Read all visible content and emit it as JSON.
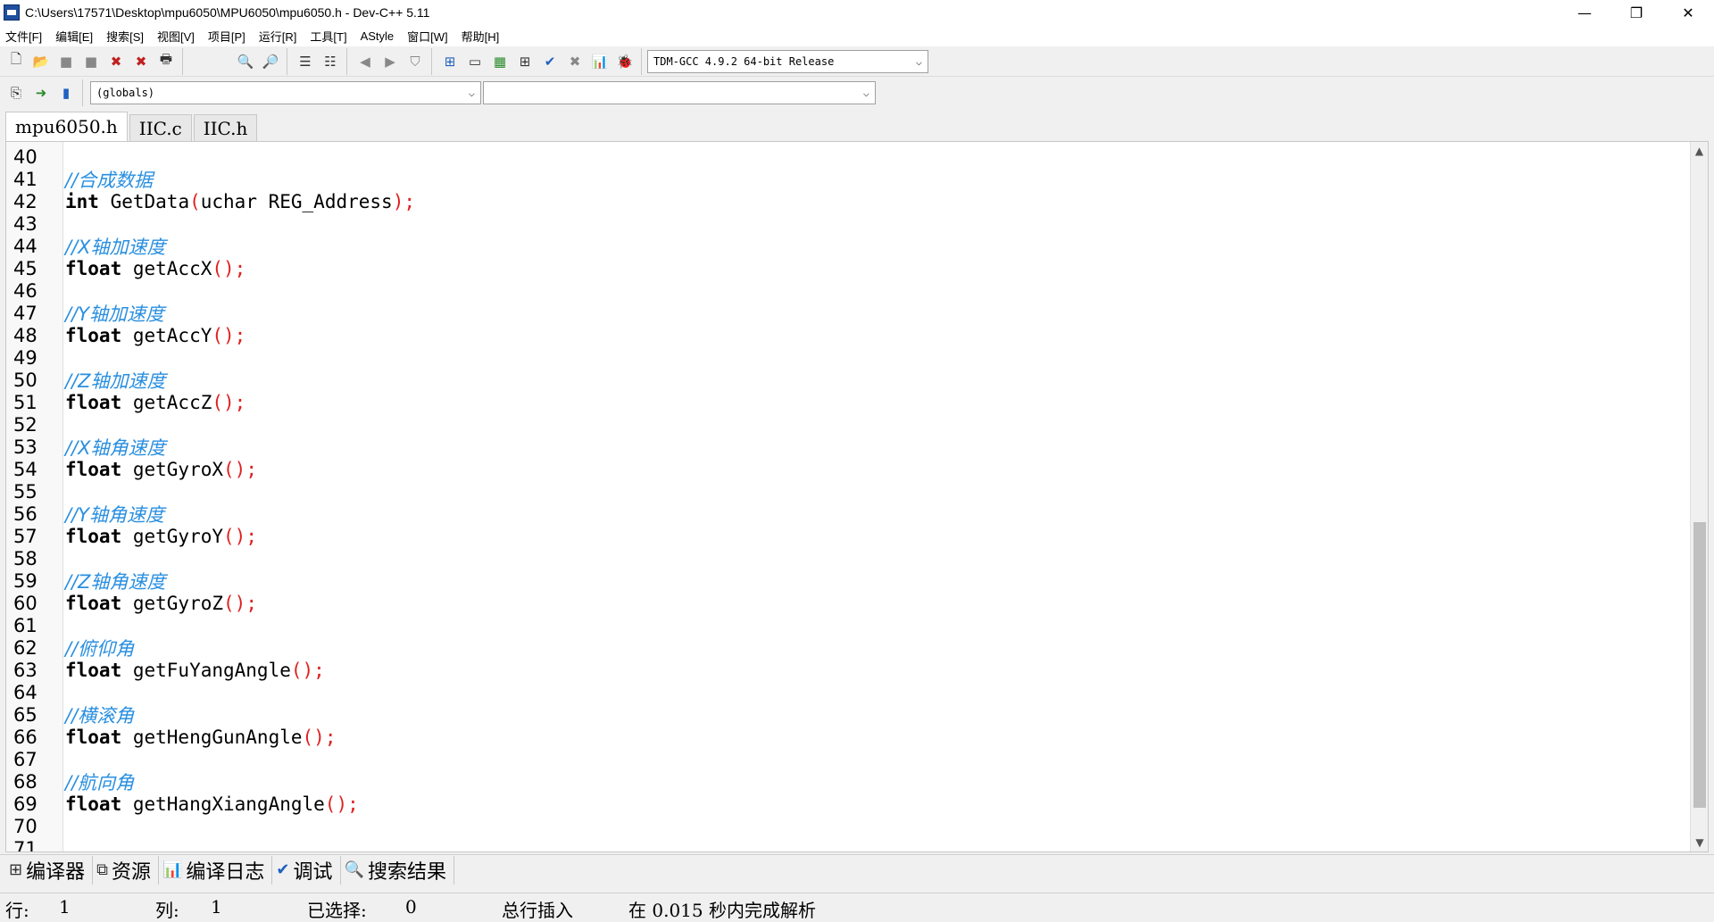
{
  "window": {
    "title": "C:\\Users\\17571\\Desktop\\mpu6050\\MPU6050\\mpu6050.h - Dev-C++ 5.11",
    "minimize": "—",
    "restore": "❐",
    "close": "✕"
  },
  "menu": [
    "文件[F]",
    "编辑[E]",
    "搜索[S]",
    "视图[V]",
    "项目[P]",
    "运行[R]",
    "工具[T]",
    "AStyle",
    "窗口[W]",
    "帮助[H]"
  ],
  "toolbar": {
    "compiler": "TDM-GCC 4.9.2 64-bit Release",
    "scope": "(globals)",
    "symbol": ""
  },
  "tabs": [
    "mpu6050.h",
    "IIC.c",
    "IIC.h"
  ],
  "code": [
    {
      "n": "40",
      "t": ""
    },
    {
      "n": "41",
      "c": "//合成数据"
    },
    {
      "n": "42",
      "k": "int",
      "f": " GetData",
      "a": "uchar REG_Address"
    },
    {
      "n": "43",
      "t": ""
    },
    {
      "n": "44",
      "c": "//X轴加速度"
    },
    {
      "n": "45",
      "k": "float",
      "f": " getAccX",
      "a": ""
    },
    {
      "n": "46",
      "t": ""
    },
    {
      "n": "47",
      "c": "//Y轴加速度"
    },
    {
      "n": "48",
      "k": "float",
      "f": " getAccY",
      "a": ""
    },
    {
      "n": "49",
      "t": ""
    },
    {
      "n": "50",
      "c": "//Z轴加速度"
    },
    {
      "n": "51",
      "k": "float",
      "f": " getAccZ",
      "a": ""
    },
    {
      "n": "52",
      "t": ""
    },
    {
      "n": "53",
      "c": "//X轴角速度"
    },
    {
      "n": "54",
      "k": "float",
      "f": " getGyroX",
      "a": ""
    },
    {
      "n": "55",
      "t": ""
    },
    {
      "n": "56",
      "c": "//Y轴角速度"
    },
    {
      "n": "57",
      "k": "float",
      "f": " getGyroY",
      "a": ""
    },
    {
      "n": "58",
      "t": ""
    },
    {
      "n": "59",
      "c": "//Z轴角速度"
    },
    {
      "n": "60",
      "k": "float",
      "f": " getGyroZ",
      "a": ""
    },
    {
      "n": "61",
      "t": ""
    },
    {
      "n": "62",
      "c": "//俯仰角"
    },
    {
      "n": "63",
      "k": "float",
      "f": " getFuYangAngle",
      "a": ""
    },
    {
      "n": "64",
      "t": ""
    },
    {
      "n": "65",
      "c": "//横滚角"
    },
    {
      "n": "66",
      "k": "float",
      "f": " getHengGunAngle",
      "a": ""
    },
    {
      "n": "67",
      "t": ""
    },
    {
      "n": "68",
      "c": "//航向角"
    },
    {
      "n": "69",
      "k": "float",
      "f": " getHangXiangAngle",
      "a": ""
    },
    {
      "n": "70",
      "t": ""
    },
    {
      "n": "71",
      "t": ""
    }
  ],
  "bottom_tabs": [
    {
      "icon": "compiler-icon",
      "label": "编译器"
    },
    {
      "icon": "resources-icon",
      "label": "资源"
    },
    {
      "icon": "compile-log-icon",
      "label": "编译日志"
    },
    {
      "icon": "debug-icon",
      "label": "调试"
    },
    {
      "icon": "search-results-icon",
      "label": "搜索结果"
    }
  ],
  "status": {
    "row_label": "行:",
    "row_value": "1",
    "col_label": "列:",
    "col_value": "1",
    "sel_label": "已选择:",
    "sel_value": "0",
    "lines_insert": "总行插入",
    "parse_msg": "在 0.015 秒内完成解析"
  }
}
